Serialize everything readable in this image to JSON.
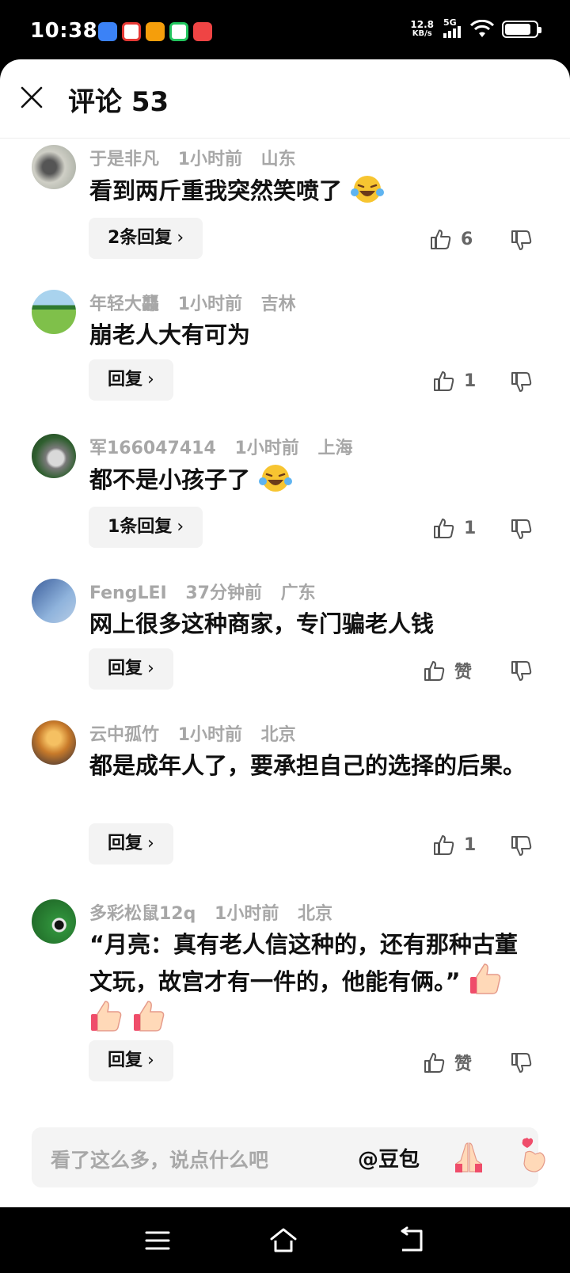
{
  "status_bar": {
    "time": "10:38",
    "net_speed_value": "12.8",
    "net_speed_unit": "KB/s",
    "network": "5G",
    "app_icons": [
      {
        "name": "blue-app-icon",
        "color": "#3b82f6"
      },
      {
        "name": "red-face-app-icon",
        "color": "#e53935"
      },
      {
        "name": "orange-app-icon",
        "color": "#f59e0b"
      },
      {
        "name": "green-app-icon",
        "color": "#22c55e"
      },
      {
        "name": "red-label-app-icon",
        "color": "#ef4444"
      }
    ],
    "battery_level": 0.78
  },
  "sheet": {
    "title": "评论 53",
    "close_icon": "close-icon"
  },
  "comments": [
    {
      "user": "于是非凡",
      "time": "1小时前",
      "location": "山东",
      "text": "看到两斤重我突然笑喷了",
      "emoji": "laughing-crying-emoji",
      "reply_label": "2条回复",
      "likes": "6"
    },
    {
      "user": "年轻大龘",
      "time": "1小时前",
      "location": "吉林",
      "text": "崩老人大有可为",
      "reply_label": "回复",
      "likes": "1"
    },
    {
      "user": "军166047414",
      "time": "1小时前",
      "location": "上海",
      "text": "都不是小孩子了",
      "emoji": "laughing-crying-emoji",
      "reply_label": "1条回复",
      "likes": "1"
    },
    {
      "user": "FengLEI",
      "time": "37分钟前",
      "location": "广东",
      "text": "网上很多这种商家，专门骗老人钱",
      "reply_label": "回复",
      "likes": "赞"
    },
    {
      "user": "云中孤竹",
      "time": "1小时前",
      "location": "北京",
      "text": "都是成年人了，要承担自己的选择的后果。",
      "reply_label": "回复",
      "likes": "1"
    },
    {
      "user": "多彩松鼠12q",
      "time": "1小时前",
      "location": "北京",
      "text": "“月亮：真有老人信这种的，还有那种古董文玩，故宫才有一件的，他能有俩。”",
      "emoji": "thumbs-up-emoji",
      "reply_label": "回复",
      "likes": "赞"
    }
  ],
  "input_bar": {
    "placeholder": "看了这么多，说点什么吧",
    "mention": "@豆包"
  },
  "nav_bar": {
    "icons": [
      "menu-icon",
      "home-icon",
      "back-icon"
    ]
  }
}
